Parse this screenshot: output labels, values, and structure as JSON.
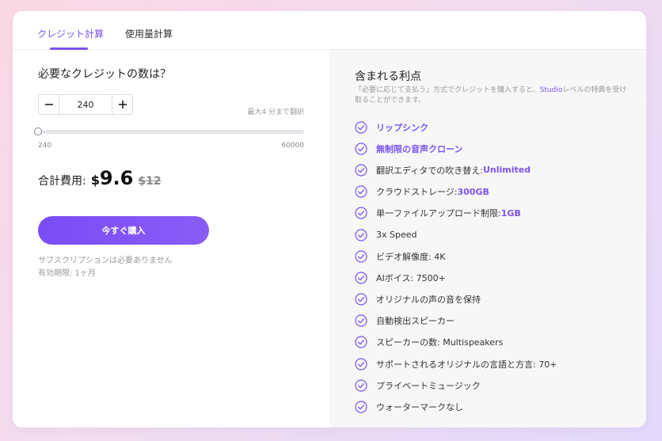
{
  "tabs": [
    {
      "label": "クレジット計算",
      "active": true
    },
    {
      "label": "使用量計算",
      "active": false
    }
  ],
  "calculator": {
    "question": "必要なクレジットの数は？",
    "value": "240",
    "hint": "最大4 分まで翻訳",
    "slider": {
      "min": 240,
      "max": 60000,
      "value": 240,
      "min_label": "240",
      "max_label": "60000"
    },
    "total_label": "合計費用:",
    "currency": "$",
    "price": "9.6",
    "old_price": "$12",
    "buy_label": "今すぐ購入",
    "note_1": "サブスクリプションは必要ありません",
    "note_2": "有効期限: 1ヶ月"
  },
  "benefits": {
    "title": "含まれる利点",
    "desc_before": "「必要に応じて支払う」方式でクレジットを購入すると、",
    "desc_highlight": "Studio",
    "desc_after": "レベルの特典を受け取ることができます。",
    "items": [
      {
        "label": "リップシンク",
        "value": ""
      },
      {
        "label": "無制限の音声クローン",
        "value": ""
      },
      {
        "label": "翻訳エディタでの吹き替え: ",
        "value": "Unlimited"
      },
      {
        "label": "クラウドストレージ: ",
        "value": "300GB"
      },
      {
        "label": "単一ファイルアップロード制限: ",
        "value": "1GB"
      },
      {
        "label": "3x Speed",
        "value": ""
      },
      {
        "label": "ビデオ解像度: 4K",
        "value": ""
      },
      {
        "label": "AIボイス: 7500+",
        "value": ""
      },
      {
        "label": "オリジナルの声の音を保持",
        "value": ""
      },
      {
        "label": "自動検出スピーカー",
        "value": ""
      },
      {
        "label": "スピーカーの数: Multispeakers",
        "value": ""
      },
      {
        "label": "サポートされるオリジナルの言語と方言: 70+",
        "value": ""
      },
      {
        "label": "プライベートミュージック",
        "value": ""
      },
      {
        "label": "ウォーターマークなし",
        "value": ""
      }
    ]
  },
  "colors": {
    "accent": "#7b54f0"
  }
}
